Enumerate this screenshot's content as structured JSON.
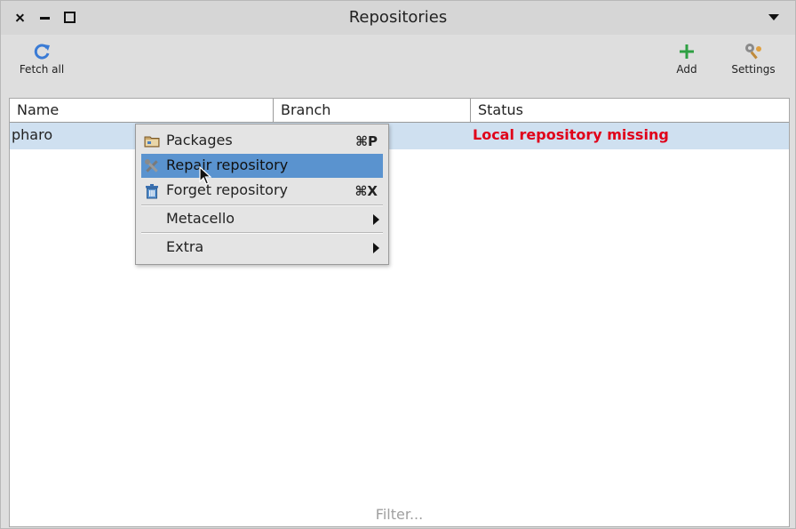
{
  "window": {
    "title": "Repositories"
  },
  "toolbar": {
    "fetch_all": "Fetch all",
    "add": "Add",
    "settings": "Settings"
  },
  "table": {
    "columns": [
      "Name",
      "Branch",
      "Status"
    ],
    "rows": [
      {
        "name": "pharo",
        "branch": "",
        "status": "Local repository missing"
      }
    ],
    "filter_placeholder": "Filter..."
  },
  "context_menu": {
    "items": [
      {
        "label": "Packages",
        "shortcut": "⌘P",
        "icon": "folder-icon"
      },
      {
        "label": "Repair repository",
        "shortcut": "",
        "icon": "wrench-icon",
        "highlighted": true
      },
      {
        "label": "Forget repository",
        "shortcut": "⌘X",
        "icon": "trash-icon"
      },
      {
        "label": "Metacello",
        "submenu": true
      },
      {
        "label": "Extra",
        "submenu": true
      }
    ]
  },
  "colors": {
    "accent": "#5a93cf",
    "error": "#e0001a",
    "selected_row": "#cfe0f0",
    "add_icon": "#2ea043",
    "fetch_icon": "#3a7bd5"
  }
}
